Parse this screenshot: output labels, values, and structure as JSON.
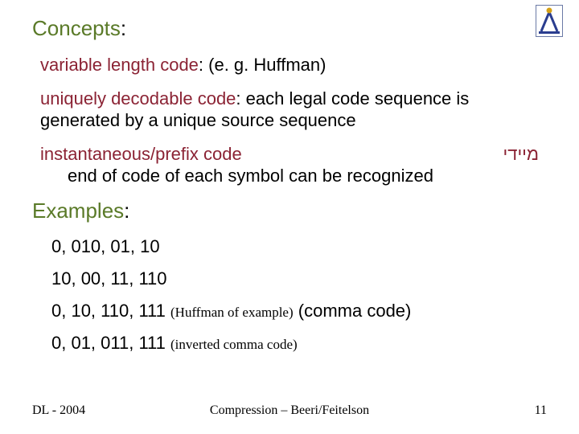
{
  "headings": {
    "concepts": "Concepts",
    "examples": "Examples",
    "colon": ":"
  },
  "concepts": {
    "varlen_term": "variable length code",
    "varlen_rest": ": (e. g. Huffman)",
    "unique_term": "uniquely decodable code",
    "unique_rest": ": each legal code sequence is generated by a unique  source sequence",
    "prefix_term": "instantaneous/prefix code",
    "prefix_hebrew": "מיידי",
    "prefix_sub": "end of code of each symbol can be recognized"
  },
  "examples": {
    "line1": "0, 010, 01, 10",
    "line2": "10, 00, 11, 110",
    "line3_codes": "0, 10, 110, 111 ",
    "line3_note1": "(Huffman of example)",
    "line3_note2": " (comma code)",
    "line4_codes": "0, 01, 011, 111 ",
    "line4_note": "(inverted comma code)"
  },
  "footer": {
    "left": "DL - 2004",
    "center": "Compression – Beeri/Feitelson",
    "right": "11"
  }
}
